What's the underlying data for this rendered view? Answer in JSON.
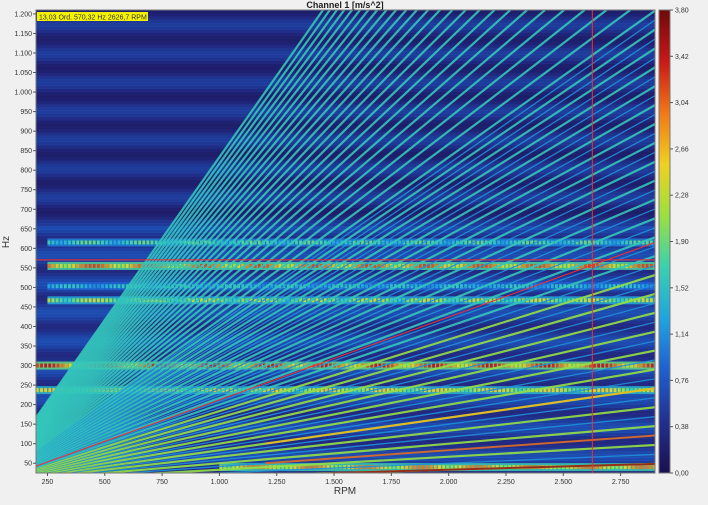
{
  "chart_data": {
    "type": "heatmap",
    "title": "Channel 1   [m/s^2]",
    "xlabel": "RPM",
    "ylabel": "Hz",
    "cursor_readout": "13,03  Ord. 570,32  Hz 2626,7  RPM",
    "xlim": [
      200,
      2900
    ],
    "ylim": [
      25,
      1210
    ],
    "x_ticks": [
      {
        "value": 250,
        "label": "250"
      },
      {
        "value": 500,
        "label": "500"
      },
      {
        "value": 750,
        "label": "750"
      },
      {
        "value": 1000,
        "label": "1.000"
      },
      {
        "value": 1250,
        "label": "1.250"
      },
      {
        "value": 1500,
        "label": "1.500"
      },
      {
        "value": 1750,
        "label": "1.750"
      },
      {
        "value": 2000,
        "label": "2.000"
      },
      {
        "value": 2250,
        "label": "2.250"
      },
      {
        "value": 2500,
        "label": "2.500"
      },
      {
        "value": 2750,
        "label": "2.750"
      }
    ],
    "y_ticks": [
      {
        "value": 50,
        "label": "50"
      },
      {
        "value": 100,
        "label": "100"
      },
      {
        "value": 150,
        "label": "150"
      },
      {
        "value": 200,
        "label": "200"
      },
      {
        "value": 250,
        "label": "250"
      },
      {
        "value": 300,
        "label": "300"
      },
      {
        "value": 350,
        "label": "350"
      },
      {
        "value": 400,
        "label": "400"
      },
      {
        "value": 450,
        "label": "450"
      },
      {
        "value": 500,
        "label": "500"
      },
      {
        "value": 550,
        "label": "550"
      },
      {
        "value": 600,
        "label": "600"
      },
      {
        "value": 650,
        "label": "650"
      },
      {
        "value": 700,
        "label": "700"
      },
      {
        "value": 750,
        "label": "750"
      },
      {
        "value": 800,
        "label": "800"
      },
      {
        "value": 850,
        "label": "850"
      },
      {
        "value": 900,
        "label": "900"
      },
      {
        "value": 950,
        "label": "950"
      },
      {
        "value": 1000,
        "label": "1.000"
      },
      {
        "value": 1050,
        "label": "1.050"
      },
      {
        "value": 1100,
        "label": "1.100"
      },
      {
        "value": 1150,
        "label": "1.150"
      },
      {
        "value": 1200,
        "label": "1.200"
      }
    ],
    "colorbar": {
      "min": 0.0,
      "max": 3.8,
      "ticks": [
        {
          "value": 0.0,
          "label": "0,00"
        },
        {
          "value": 0.38,
          "label": "0,38"
        },
        {
          "value": 0.76,
          "label": "0,76"
        },
        {
          "value": 1.14,
          "label": "1,14"
        },
        {
          "value": 1.52,
          "label": "1,52"
        },
        {
          "value": 1.9,
          "label": "1,90"
        },
        {
          "value": 2.28,
          "label": "2,28"
        },
        {
          "value": 2.66,
          "label": "2,66"
        },
        {
          "value": 3.04,
          "label": "3,04"
        },
        {
          "value": 3.42,
          "label": "3,42"
        },
        {
          "value": 3.8,
          "label": "3,80"
        }
      ],
      "colors": [
        "#1a1050",
        "#23308f",
        "#1f5fd0",
        "#20a4e0",
        "#3ad0b0",
        "#9ae040",
        "#f0d020",
        "#f07818",
        "#c81818",
        "#6e0a0a"
      ]
    },
    "cursor": {
      "rpm": 2626.7,
      "hz": 570.32
    },
    "order_line_12_72": [
      {
        "rpm": 200,
        "hz": 42.5
      },
      {
        "rpm": 2900,
        "hz": 615
      }
    ],
    "orders": [
      0.5,
      1,
      1.5,
      2,
      2.5,
      3,
      3.5,
      4,
      4.5,
      5,
      5.5,
      6,
      6.5,
      7,
      7.5,
      8,
      8.5,
      9,
      9.5,
      10,
      10.5,
      11,
      11.5,
      12,
      12.5,
      13,
      13.5,
      14,
      14.5,
      15,
      15.5,
      16,
      16.5,
      17,
      17.5,
      18,
      18.5,
      19,
      19.5,
      20,
      20.5,
      21,
      21.5,
      22,
      22.5,
      23,
      23.5,
      24,
      24.5,
      25,
      26,
      27,
      28,
      29,
      30,
      31,
      32,
      33,
      34,
      35,
      36,
      37,
      38,
      39,
      40,
      41,
      42,
      43,
      44,
      45,
      46,
      47,
      48,
      49,
      50
    ],
    "resonance_bands": [
      {
        "hz": 300,
        "rpm_range": [
          200,
          2900
        ],
        "level": 3.4
      },
      {
        "hz": 237,
        "rpm_range": [
          200,
          2900
        ],
        "level": 2.6
      },
      {
        "hz": 555,
        "rpm_range": [
          250,
          2900
        ],
        "level": 3.2
      },
      {
        "hz": 615,
        "rpm_range": [
          250,
          2900
        ],
        "level": 1.9
      },
      {
        "hz": 467,
        "rpm_range": [
          250,
          2900
        ],
        "level": 2.4
      },
      {
        "hz": 503,
        "rpm_range": [
          250,
          2900
        ],
        "level": 1.6
      },
      {
        "hz": 40,
        "rpm_range": [
          1000,
          2900
        ],
        "level": 3.0
      }
    ]
  }
}
